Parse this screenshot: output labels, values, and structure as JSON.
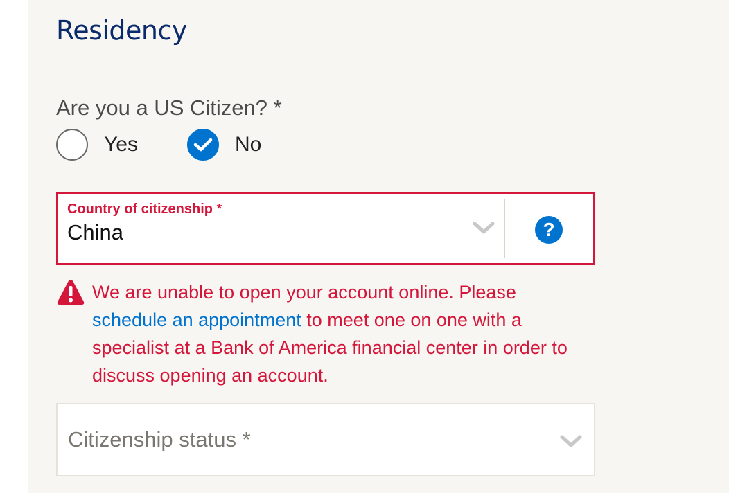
{
  "section": {
    "title": "Residency"
  },
  "citizen_question": {
    "label": "Are you a US Citizen? *",
    "options": [
      {
        "label": "Yes",
        "selected": false
      },
      {
        "label": "No",
        "selected": true
      }
    ]
  },
  "country_select": {
    "label": "Country of citizenship *",
    "value": "China",
    "chevron_icon": "chevron-down-icon",
    "help_icon": "question-mark-icon",
    "help_glyph": "?",
    "state": "error"
  },
  "error_message": {
    "icon": "warning-triangle-icon",
    "text_before": "We are unable to open your account online. Please ",
    "link_text": "schedule an appointment",
    "text_after": " to meet one on one with a specialist at a Bank of America financial center in order to discuss opening an account."
  },
  "status_select": {
    "placeholder": "Citizenship status *",
    "value": "",
    "chevron_icon": "chevron-down-icon"
  },
  "colors": {
    "heading": "#0a2a6b",
    "error": "#d4163a",
    "accent_blue": "#0073cf",
    "panel_background": "#f7f6f3"
  }
}
